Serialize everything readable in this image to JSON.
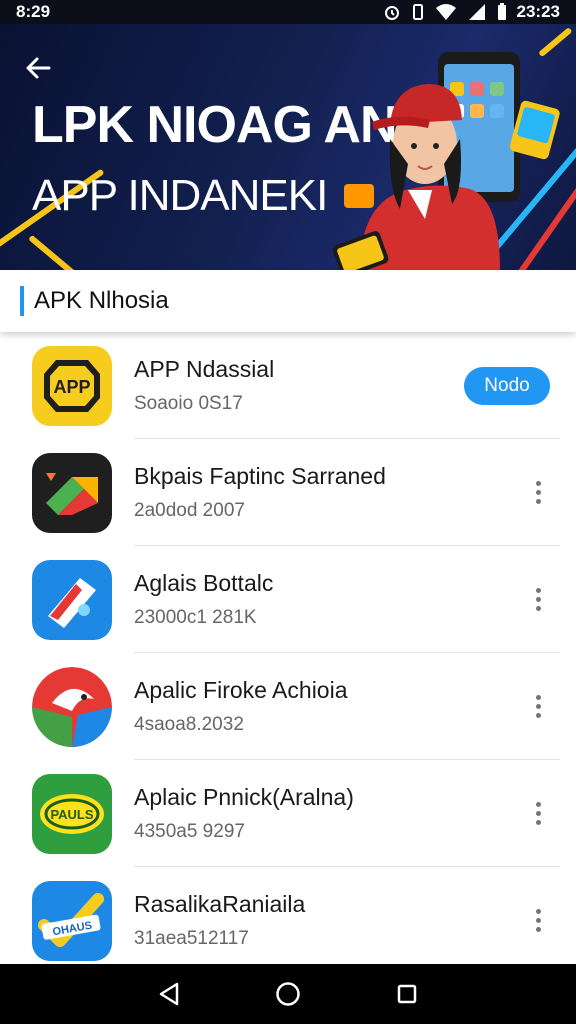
{
  "status_bar": {
    "time_left": "8:29",
    "time_right": "23:23"
  },
  "hero": {
    "title": "LPK NIOAG AN",
    "subtitle": "APP INDANEKI",
    "back_icon": "arrow-left-icon",
    "colors": {
      "background": "#12204f",
      "stripe_yellow": "#f5c518",
      "stripe_cyan": "#29b6f6",
      "stripe_red": "#e53935"
    }
  },
  "section": {
    "title": "APK Nlhosia",
    "accent_color": "#2196f3"
  },
  "apps": [
    {
      "name": "APP Ndassial",
      "meta": "Soaoio 0S17",
      "action": "Nodo",
      "icon_label": "APP"
    },
    {
      "name": "Bkpais Faptinc Sarraned",
      "meta": "2a0dod 2007"
    },
    {
      "name": "Aglais Bottalc",
      "meta": "23000c1 281K"
    },
    {
      "name": "Apalic Firoke Achioia",
      "meta": "4saoa8.2032"
    },
    {
      "name": "Aplaic Pnnick(Aralna)",
      "meta": "4350a5 9297",
      "icon_label": "PAULS"
    },
    {
      "name": "RasalikaRaniaila",
      "meta": "31aea512117",
      "icon_label": "OHAUS"
    }
  ],
  "nav": {
    "back_icon": "triangle-back-icon",
    "home_icon": "circle-home-icon",
    "recents_icon": "square-recents-icon"
  }
}
